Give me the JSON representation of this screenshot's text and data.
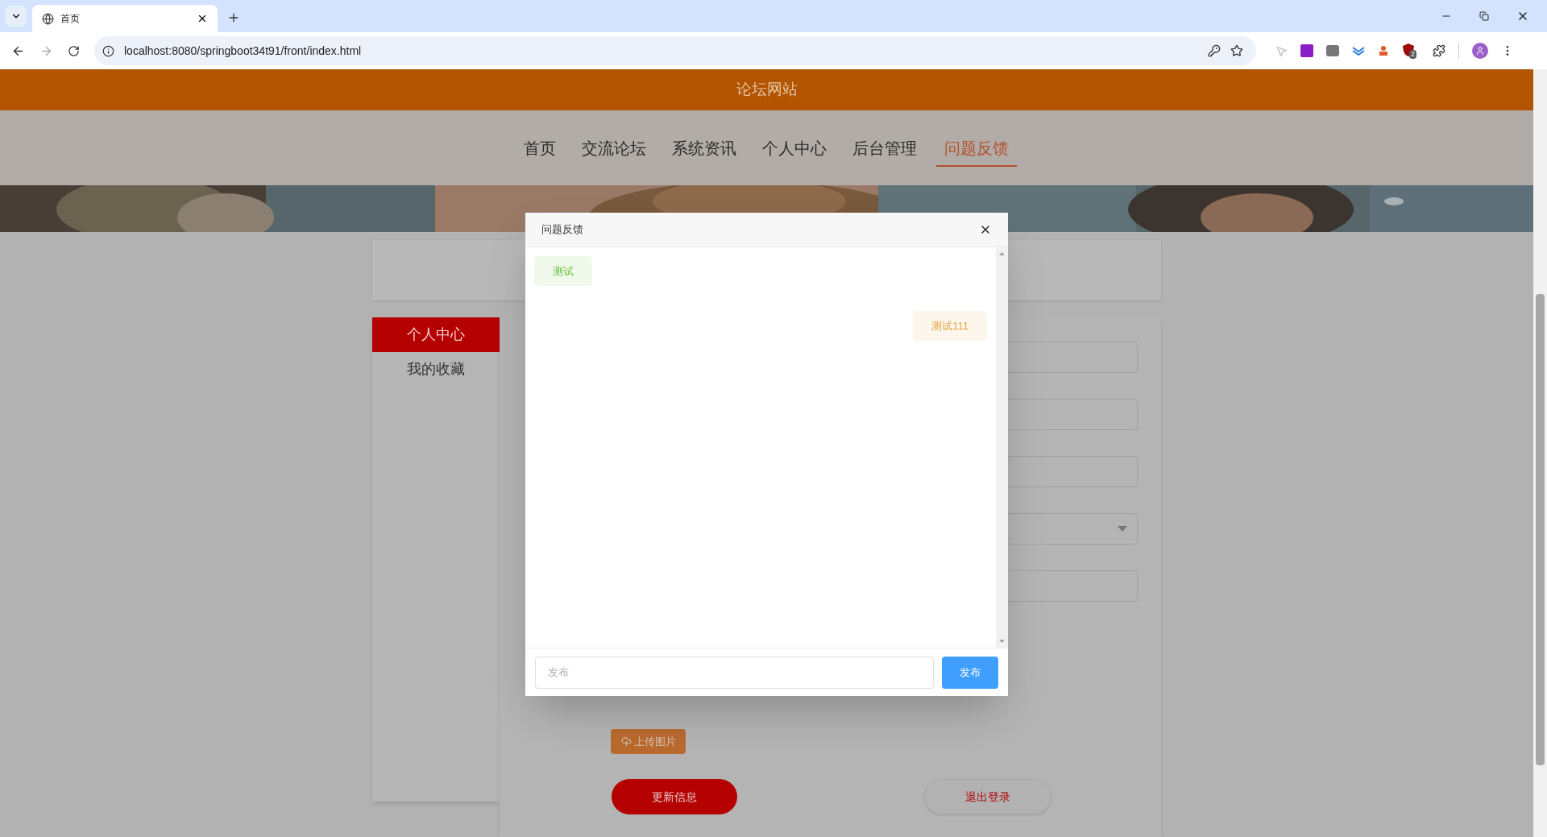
{
  "browser": {
    "tab_title": "首页",
    "url": "localhost:8080/springboot34t91/front/index.html",
    "extension_badge": "2"
  },
  "site": {
    "title": "论坛网站",
    "nav": [
      {
        "label": "首页",
        "selected": false
      },
      {
        "label": "交流论坛",
        "selected": false
      },
      {
        "label": "系统资讯",
        "selected": false
      },
      {
        "label": "个人中心",
        "selected": false
      },
      {
        "label": "后台管理",
        "selected": false
      },
      {
        "label": "问题反馈",
        "selected": true
      }
    ]
  },
  "sidebar": [
    {
      "label": "个人中心",
      "selected": true
    },
    {
      "label": "我的收藏",
      "selected": false
    }
  ],
  "profile_form": {
    "fields": [
      {
        "kind": "input"
      },
      {
        "kind": "input"
      },
      {
        "kind": "input"
      },
      {
        "kind": "select"
      },
      {
        "kind": "input"
      }
    ],
    "upload_button": "上传图片",
    "update_button": "更新信息",
    "logout_button": "退出登录"
  },
  "dialog": {
    "title": "问题反馈",
    "messages": [
      {
        "kind": "received",
        "text": "测试"
      },
      {
        "kind": "sent",
        "text": "测试111"
      }
    ],
    "input": {
      "placeholder": "发布"
    },
    "send_button": "发布"
  }
}
